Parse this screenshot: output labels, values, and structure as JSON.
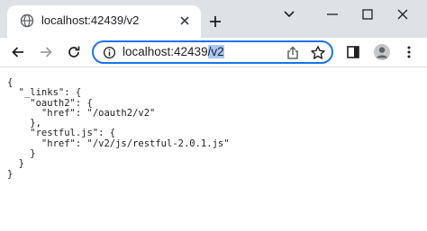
{
  "tab": {
    "title": "localhost:42439/v2"
  },
  "window_controls": [
    "minimize",
    "maximize",
    "close"
  ],
  "address_bar": {
    "host_text": "localhost:42439",
    "selected_text": "/v2"
  },
  "page": {
    "content": "{\n  \"_links\": {\n    \"oauth2\": {\n      \"href\": \"/oauth2/v2\"\n    },\n    \"restful.js\": {\n      \"href\": \"/v2/js/restful-2.0.1.js\"\n    }\n  }\n}"
  },
  "colors": {
    "tabstrip_bg": "#dee1e6",
    "omnibox_focus": "#1a73e8",
    "selection": "#a8c7fa",
    "icon": "#5f6368"
  },
  "icons": [
    "globe-icon",
    "close-icon",
    "plus-icon",
    "chevron-down-icon",
    "minimize-icon",
    "maximize-icon",
    "window-close-icon",
    "back-arrow-icon",
    "forward-arrow-icon",
    "reload-icon",
    "info-icon",
    "share-icon",
    "star-icon",
    "side-panel-icon",
    "profile-icon",
    "kebab-menu-icon"
  ]
}
